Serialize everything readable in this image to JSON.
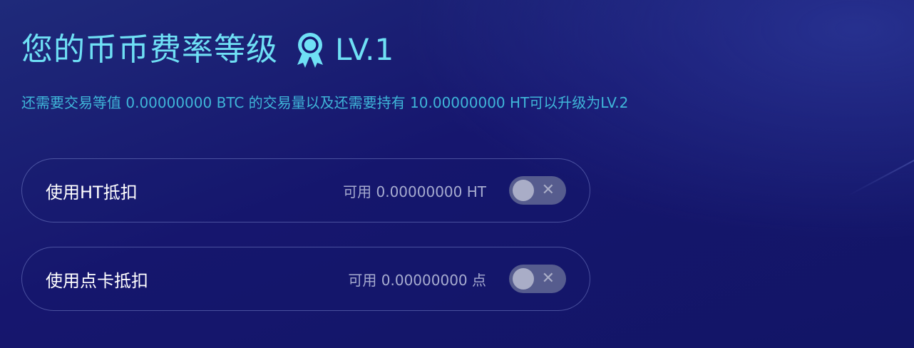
{
  "header": {
    "title": "您的币币费率等级",
    "medal_icon": "award-medal-icon",
    "level": "LV.1",
    "subtitle": "还需要交易等值 0.00000000 BTC 的交易量以及还需要持有 10.00000000 HT可以升级为LV.2"
  },
  "deductions": [
    {
      "label": "使用HT抵扣",
      "available": "可用 0.00000000 HT",
      "enabled": false,
      "toggle_icon": "close-x-icon"
    },
    {
      "label": "使用点卡抵扣",
      "available": "可用 0.00000000 点",
      "enabled": false,
      "toggle_icon": "close-x-icon"
    }
  ],
  "colors": {
    "accent": "#6fe0f5",
    "subtitle": "#3fb6d9",
    "background": "#16166e",
    "toggle_off": "#565c8e"
  }
}
